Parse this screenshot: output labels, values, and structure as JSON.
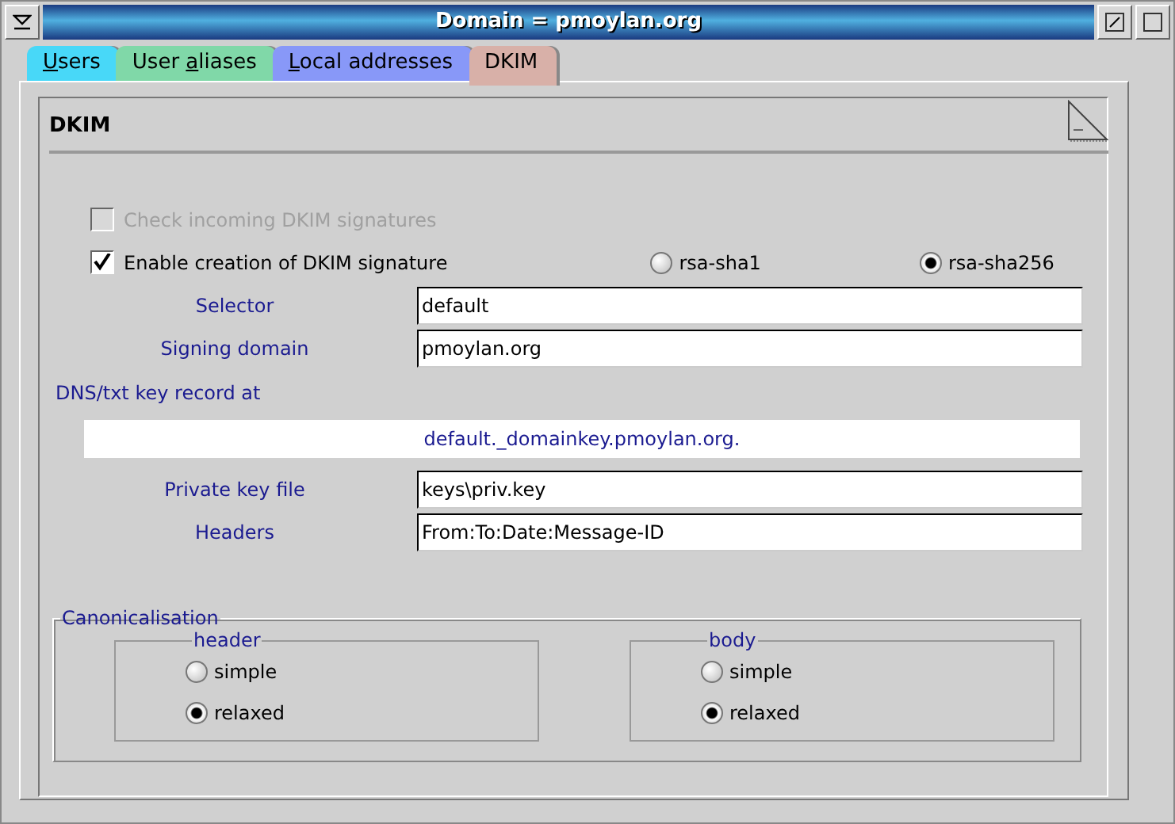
{
  "window": {
    "title": "Domain = pmoylan.org"
  },
  "tabs": [
    {
      "label": {
        "mnemonic": "U",
        "after": "sers"
      },
      "color": "#48d8f8",
      "selected": false
    },
    {
      "label": {
        "before": "User ",
        "mnemonic": "a",
        "after": "liases"
      },
      "color": "#80d8a8",
      "selected": false
    },
    {
      "label": {
        "mnemonic": "L",
        "after": "ocal addresses"
      },
      "color": "#8898f8",
      "selected": false
    },
    {
      "label": "DKIM",
      "color": "#d8b0a8",
      "selected": true
    }
  ],
  "page": {
    "heading": "DKIM",
    "check_incoming": {
      "label": "Check incoming DKIM signatures",
      "checked": false,
      "disabled": true
    },
    "enable_signing": {
      "label": "Enable creation of DKIM signature",
      "checked": true,
      "disabled": false
    },
    "algorithms": [
      {
        "label": "rsa-sha1",
        "selected": false
      },
      {
        "label": "rsa-sha256",
        "selected": true
      }
    ],
    "fields_top": [
      {
        "label": "Selector",
        "value": "default"
      },
      {
        "label": "Signing domain",
        "value": "pmoylan.org"
      }
    ],
    "dns_label": "DNS/txt key record at",
    "dns_value": "default._domainkey.pmoylan.org.",
    "fields_bottom": [
      {
        "label": "Private key file",
        "value": "keys\\priv.key"
      },
      {
        "label": "Headers",
        "value": "From:To:Date:Message-ID"
      }
    ],
    "canonicalisation": {
      "title": "Canonicalisation",
      "groups": [
        {
          "title": "header",
          "options": [
            {
              "label": "simple",
              "selected": false
            },
            {
              "label": "relaxed",
              "selected": true
            }
          ]
        },
        {
          "title": "body",
          "options": [
            {
              "label": "simple",
              "selected": false
            },
            {
              "label": "relaxed",
              "selected": true
            }
          ]
        }
      ]
    }
  }
}
